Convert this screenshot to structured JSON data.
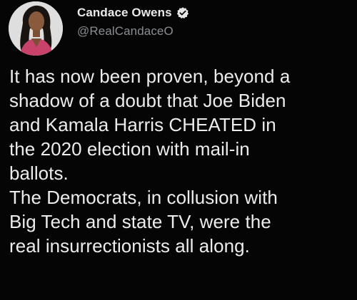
{
  "author": {
    "display_name": "Candace Owens",
    "handle": "@RealCandaceO",
    "verified_icon": "verified-badge-icon",
    "avatar_icon": "profile-photo"
  },
  "tweet": {
    "lines": [
      "It has now been proven, beyond a",
      "shadow of a doubt that Joe Biden",
      "and Kamala Harris CHEATED in",
      "the 2020 election with mail-in",
      "ballots.",
      "The Democrats, in collusion with",
      "Big Tech and state TV, were the",
      "real insurrectionists all along."
    ]
  },
  "colors": {
    "background": "#050505",
    "text": "#ececec",
    "handle": "#8a8d91"
  }
}
